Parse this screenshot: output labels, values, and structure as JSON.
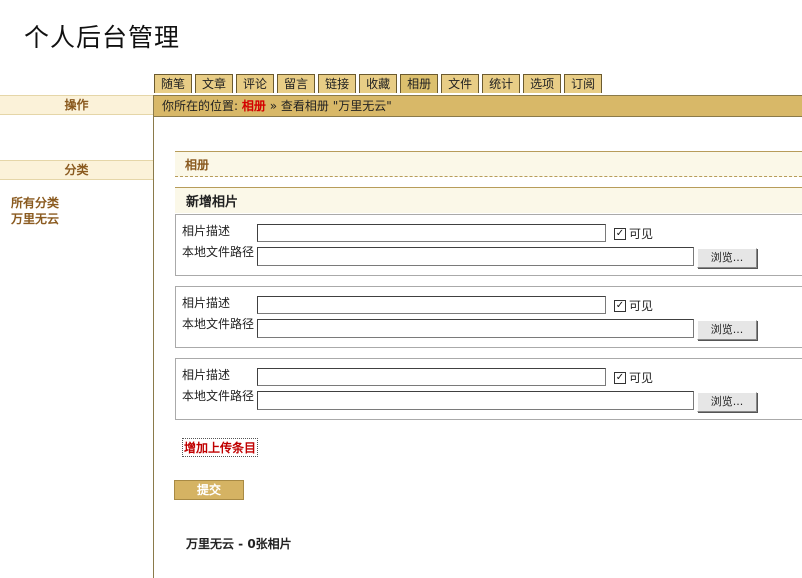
{
  "site": {
    "title": "个人后台管理"
  },
  "tabs": [
    {
      "label": "随笔"
    },
    {
      "label": "文章"
    },
    {
      "label": "评论"
    },
    {
      "label": "留言"
    },
    {
      "label": "链接"
    },
    {
      "label": "收藏"
    },
    {
      "label": "相册",
      "active": true
    },
    {
      "label": "文件"
    },
    {
      "label": "统计"
    },
    {
      "label": "选项"
    },
    {
      "label": "订阅"
    }
  ],
  "sidebar": {
    "ops_header": "操作",
    "cats_header": "分类",
    "categories": [
      {
        "label": "所有分类"
      },
      {
        "label": "万里无云"
      }
    ]
  },
  "location": {
    "prefix": "你所在的位置:",
    "current": "相册",
    "separator": "»",
    "rest": "查看相册 \"万里无云\""
  },
  "album_section": {
    "title": "相册"
  },
  "new_photos": {
    "title": "新增相片"
  },
  "upload_form": {
    "desc_label": "相片描述",
    "path_label": "本地文件路径",
    "visible_label": "可见",
    "visible_mark": "✓",
    "browse_label": "浏览...",
    "rows": [
      {
        "desc_value": "",
        "path_value": "",
        "visible": true
      },
      {
        "desc_value": "",
        "path_value": "",
        "visible": true
      },
      {
        "desc_value": "",
        "path_value": "",
        "visible": true
      }
    ]
  },
  "add_upload_link": "增加上传条目",
  "submit_label": "提交",
  "summary": "万里无云 - 0张相片",
  "colors": {
    "tab_bg": "#e8cd86",
    "location_bar": "#d8b868",
    "accent_red": "#d40000",
    "submit_bg": "#d5b363"
  }
}
